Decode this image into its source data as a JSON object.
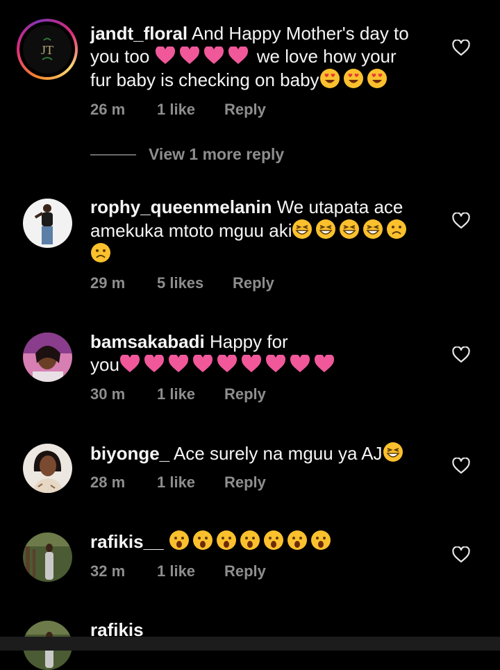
{
  "comments": [
    {
      "username": "jandt_floral",
      "text_line1": "And Happy Mother's day to",
      "text_line2a": "you too",
      "text_line2b": "we love how your",
      "text_line3": "fur baby is checking on baby",
      "time": "26 m",
      "likes": "1 like",
      "reply": "Reply",
      "avatar_text": "JT"
    },
    {
      "username": "rophy_queenmelanin",
      "text_line1": "We utapata ace",
      "text_line2": "amekuka mtoto mguu aki",
      "time": "29 m",
      "likes": "5 likes",
      "reply": "Reply"
    },
    {
      "username": "bamsakabadi",
      "text_line1": "Happy for",
      "text_line2": "you",
      "time": "30 m",
      "likes": "1 like",
      "reply": "Reply"
    },
    {
      "username": "biyonge_",
      "text_line1": "Ace surely na mguu ya AJ",
      "time": "28 m",
      "likes": "1 like",
      "reply": "Reply"
    },
    {
      "username": "rafikis__",
      "time": "32 m",
      "likes": "1 like",
      "reply": "Reply"
    },
    {
      "username": "rafikis__"
    }
  ],
  "view_more": "View 1 more reply",
  "colors": {
    "background": "#000000",
    "text": "#f5f5f5",
    "meta": "#8e8e8e",
    "emoji_heart": "#f0589a"
  },
  "icons": {
    "like": "heart-outline-icon",
    "emoji_heart": "pink-heart-emoji",
    "heart_eyes": "heart-eyes-emoji",
    "grin": "grinning-squint-emoji",
    "frown": "frowning-emoji",
    "surprised": "surprised-face-emoji"
  }
}
